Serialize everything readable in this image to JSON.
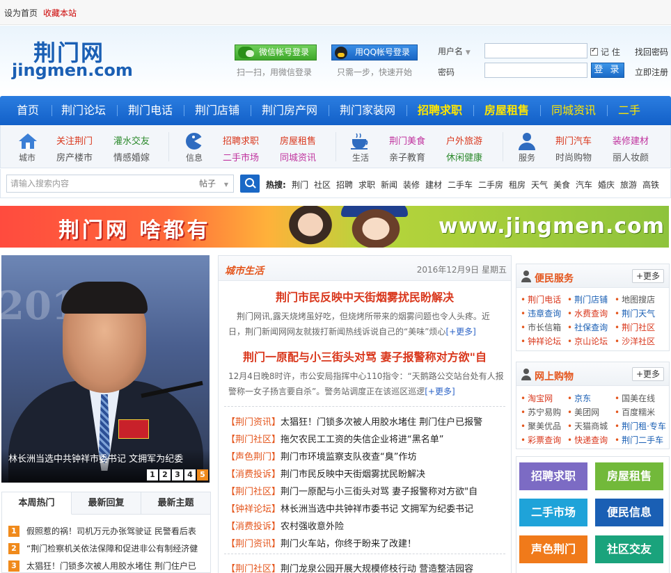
{
  "topbar": {
    "set_home": "设为首页",
    "bookmark": "收藏本站"
  },
  "logo": {
    "cn": "荆门网",
    "en": "jingmen.com"
  },
  "login": {
    "wechat_btn": "微信帐号登录",
    "wechat_tip": "扫一扫，用微信登录",
    "qq_btn": "用QQ帐号登录",
    "qq_tip": "只需一步，快速开始",
    "username_label": "用户名",
    "password_label": "密码",
    "remember": "记 住",
    "submit": "登 录",
    "find_password": "找回密码",
    "register": "立即注册"
  },
  "nav": [
    "首页",
    "荆门论坛",
    "荆门电话",
    "荆门店铺",
    "荆门房产网",
    "荆门家装网",
    "招聘求职",
    "房屋租售",
    "同城资讯",
    "二手"
  ],
  "subnav": {
    "groups": [
      {
        "label": "城市",
        "links": [
          [
            "关注荆门",
            "灌水交友"
          ],
          [
            "房产楼市",
            "情感婚嫁"
          ]
        ]
      },
      {
        "label": "信息",
        "links": [
          [
            "招聘求职",
            "房屋租售"
          ],
          [
            "二手市场",
            "同城资讯"
          ]
        ]
      },
      {
        "label": "生活",
        "links": [
          [
            "荆门美食",
            "户外旅游"
          ],
          [
            "亲子教育",
            "休闲健康"
          ]
        ]
      },
      {
        "label": "服务",
        "links": [
          [
            "荆门汽车",
            "装修建材"
          ],
          [
            "时尚购物",
            "丽人妆颜"
          ]
        ]
      }
    ]
  },
  "search": {
    "placeholder": "请输入搜索内容",
    "scope": "帖子",
    "hot_label": "热搜:",
    "hot": [
      "荆门",
      "社区",
      "招聘",
      "求职",
      "新闻",
      "装修",
      "建材",
      "二手车",
      "二手房",
      "租房",
      "天气",
      "美食",
      "汽车",
      "婚庆",
      "旅游",
      "高铁"
    ]
  },
  "banner": {
    "left": "荆门网 啥都有",
    "right": "www.jingmen.com"
  },
  "slider": {
    "caption": "林长洲当选中共钟祥市委书记 文拥军为纪委",
    "pages": [
      "1",
      "2",
      "3",
      "4",
      "5"
    ]
  },
  "left_tabs": {
    "tabs": [
      "本周热门",
      "最新回复",
      "最新主题"
    ],
    "items": [
      {
        "n": "1",
        "text": "假照惹的祸！司机万元办张驾驶证 民警看后表"
      },
      {
        "n": "2",
        "text": "“荆门检察机关依法保障和促进非公有制经济健"
      },
      {
        "n": "3",
        "text": "太猖狂！门锁多次被人用胶水堵住 荆门住户已"
      }
    ]
  },
  "city": {
    "title": "城市生活",
    "date": "2016年12月9日 星期五",
    "h1": "荆门市民反映中天街烟雾扰民盼解决",
    "s1": "荆门网讯,露天烧烤虽好吃，但烧烤所带来的烟雾问题也令人头疼。近日，荆门新闻网网友就拨打新闻热线诉说自己的“美味”烦心",
    "h2": "荆门一原配与小三街头对骂 妻子报警称对方欲\"自",
    "s2": "12月4日晚8时许，市公安局指挥中心110指令：“天鹅路公交站台处有人报警称一女子扬言要自杀”。警务站调度正在该巡区巡逻",
    "more": "[+更多]",
    "news": [
      {
        "tag": "【荆门资讯】",
        "text": "太猖狂！门锁多次被人用胶水堵住 荆门住户已报警"
      },
      {
        "tag": "【荆门社区】",
        "text": "拖欠农民工工资的失信企业将进“黑名单”"
      },
      {
        "tag": "【声色荆门】",
        "text": "荆门市环境监察支队夜查“臭”作坊"
      },
      {
        "tag": "【消费投诉】",
        "text": "荆门市民反映中天街烟雾扰民盼解决"
      },
      {
        "tag": "【荆门社区】",
        "text": "荆门一原配与小三街头对骂 妻子报警称对方欲\"自"
      },
      {
        "tag": "【钟祥论坛】",
        "text": "林长洲当选中共钟祥市委书记 文拥军为纪委书记"
      },
      {
        "tag": "【消费投诉】",
        "text": "农村强收意外险"
      },
      {
        "tag": "【荆门资讯】",
        "text": "荆门火车站，你终于盼来了改建！"
      },
      {
        "tag": "【荆门社区】",
        "text": "荆门龙泉公园开展大规模修枝行动 营造整洁园容"
      }
    ]
  },
  "service": {
    "title": "便民服务",
    "more": "+更多",
    "items": [
      {
        "t": "荆门电话",
        "c": "#d9361b"
      },
      {
        "t": "荆门店铺",
        "c": "#1a5fb4"
      },
      {
        "t": "地图搜店",
        "c": "#555555"
      },
      {
        "t": "违章查询",
        "c": "#1a5fb4"
      },
      {
        "t": "水费查询",
        "c": "#d9361b"
      },
      {
        "t": "荆门天气",
        "c": "#1a5fb4"
      },
      {
        "t": "市长信箱",
        "c": "#555555"
      },
      {
        "t": "社保查询",
        "c": "#1a5fb4"
      },
      {
        "t": "荆门社区",
        "c": "#d9361b"
      },
      {
        "t": "钟祥论坛",
        "c": "#d9361b"
      },
      {
        "t": "京山论坛",
        "c": "#d9361b"
      },
      {
        "t": "沙洋社区",
        "c": "#d9361b"
      }
    ]
  },
  "shop": {
    "title": "网上购物",
    "more": "+更多",
    "items": [
      {
        "t": "淘宝网",
        "c": "#d9361b"
      },
      {
        "t": "京东",
        "c": "#1a5fb4"
      },
      {
        "t": "国美在线",
        "c": "#555555"
      },
      {
        "t": "苏宁易购",
        "c": "#555555"
      },
      {
        "t": "美团网",
        "c": "#555555"
      },
      {
        "t": "百度糯米",
        "c": "#555555"
      },
      {
        "t": "聚美优品",
        "c": "#555555"
      },
      {
        "t": "天猫商城",
        "c": "#555555"
      },
      {
        "t": "荆门租·专车",
        "c": "#1a5fb4"
      },
      {
        "t": "彩票查询",
        "c": "#d9361b"
      },
      {
        "t": "快递查询",
        "c": "#d9361b"
      },
      {
        "t": "荆门二手车",
        "c": "#1a5fb4"
      }
    ]
  },
  "tiles": [
    {
      "t": "招聘求职",
      "c": "#7c6bc4"
    },
    {
      "t": "房屋租售",
      "c": "#72b93a"
    },
    {
      "t": "二手市场",
      "c": "#1fa3d9"
    },
    {
      "t": "便民信息",
      "c": "#1a5fb4"
    },
    {
      "t": "声色荆门",
      "c": "#f07a1a"
    },
    {
      "t": "社区交友",
      "c": "#1aa37c"
    }
  ]
}
